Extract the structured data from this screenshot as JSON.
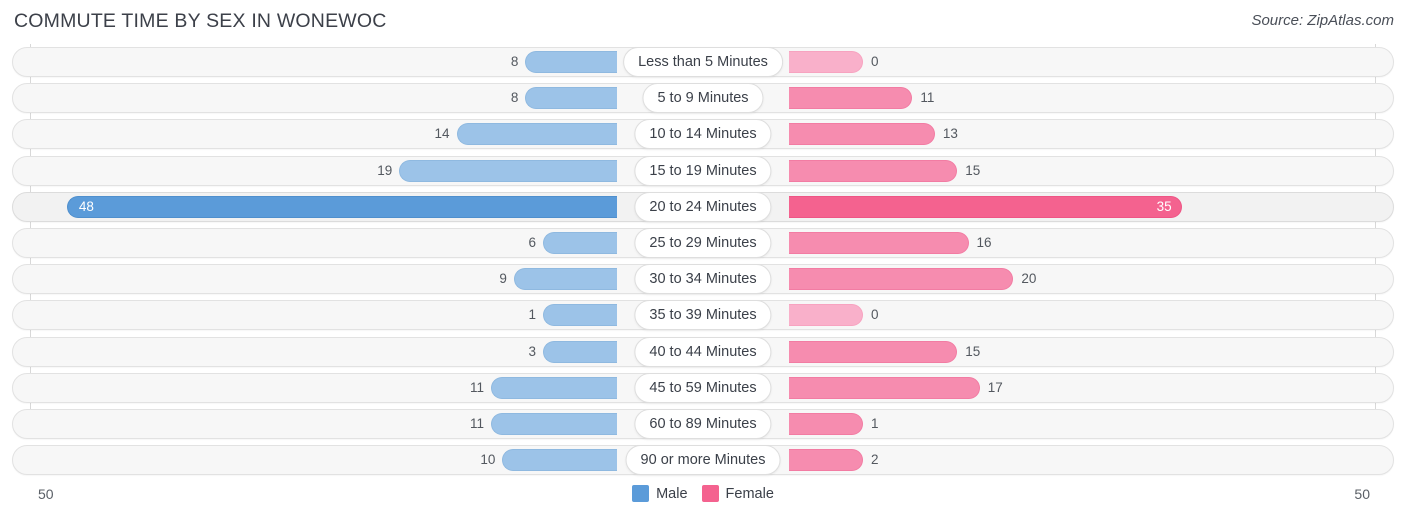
{
  "header": {
    "title": "COMMUTE TIME BY SEX IN WONEWOC",
    "source": "Source: ZipAtlas.com"
  },
  "axis": {
    "left_label": "50",
    "right_label": "50",
    "max": 50
  },
  "legend": {
    "male_label": "Male",
    "female_label": "Female",
    "male_color": "#5b9bd9",
    "female_color": "#f4628f"
  },
  "colors": {
    "male_bar": "#9cc3e8",
    "female_bar": "#f68caf",
    "male_bar_highlight": "#5b9bd9",
    "female_bar_highlight": "#f4628f",
    "male_bar_zero": "#b9d4ee",
    "female_bar_zero": "#f9b0ca",
    "track": "#f7f7f7"
  },
  "chart_data": {
    "type": "bar",
    "title": "COMMUTE TIME BY SEX IN WONEWOC",
    "subtitle": "Source: ZipAtlas.com",
    "orientation": "horizontal-diverging",
    "xlabel": "",
    "ylabel": "",
    "xlim": [
      50,
      50
    ],
    "grid": false,
    "legend_position": "bottom-center",
    "categories": [
      "Less than 5 Minutes",
      "5 to 9 Minutes",
      "10 to 14 Minutes",
      "15 to 19 Minutes",
      "20 to 24 Minutes",
      "25 to 29 Minutes",
      "30 to 34 Minutes",
      "35 to 39 Minutes",
      "40 to 44 Minutes",
      "45 to 59 Minutes",
      "60 to 89 Minutes",
      "90 or more Minutes"
    ],
    "series": [
      {
        "name": "Male",
        "values": [
          8,
          8,
          14,
          19,
          48,
          6,
          9,
          1,
          3,
          11,
          11,
          10
        ]
      },
      {
        "name": "Female",
        "values": [
          0,
          11,
          13,
          15,
          35,
          16,
          20,
          0,
          15,
          17,
          1,
          2
        ]
      }
    ],
    "highlighted_category": "20 to 24 Minutes"
  },
  "rows": [
    {
      "label": "Less than 5 Minutes",
      "male": 8,
      "female": 0,
      "male_text": "8",
      "female_text": "0",
      "highlight": false
    },
    {
      "label": "5 to 9 Minutes",
      "male": 8,
      "female": 11,
      "male_text": "8",
      "female_text": "11",
      "highlight": false
    },
    {
      "label": "10 to 14 Minutes",
      "male": 14,
      "female": 13,
      "male_text": "14",
      "female_text": "13",
      "highlight": false
    },
    {
      "label": "15 to 19 Minutes",
      "male": 19,
      "female": 15,
      "male_text": "19",
      "female_text": "15",
      "highlight": false
    },
    {
      "label": "20 to 24 Minutes",
      "male": 48,
      "female": 35,
      "male_text": "48",
      "female_text": "35",
      "highlight": true
    },
    {
      "label": "25 to 29 Minutes",
      "male": 6,
      "female": 16,
      "male_text": "6",
      "female_text": "16",
      "highlight": false
    },
    {
      "label": "30 to 34 Minutes",
      "male": 9,
      "female": 20,
      "male_text": "9",
      "female_text": "20",
      "highlight": false
    },
    {
      "label": "35 to 39 Minutes",
      "male": 1,
      "female": 0,
      "male_text": "1",
      "female_text": "0",
      "highlight": false
    },
    {
      "label": "40 to 44 Minutes",
      "male": 3,
      "female": 15,
      "male_text": "3",
      "female_text": "15",
      "highlight": false
    },
    {
      "label": "45 to 59 Minutes",
      "male": 11,
      "female": 17,
      "male_text": "11",
      "female_text": "17",
      "highlight": false
    },
    {
      "label": "60 to 89 Minutes",
      "male": 11,
      "female": 1,
      "male_text": "11",
      "female_text": "1",
      "highlight": false
    },
    {
      "label": "90 or more Minutes",
      "male": 10,
      "female": 2,
      "male_text": "10",
      "female_text": "2",
      "highlight": false
    }
  ]
}
